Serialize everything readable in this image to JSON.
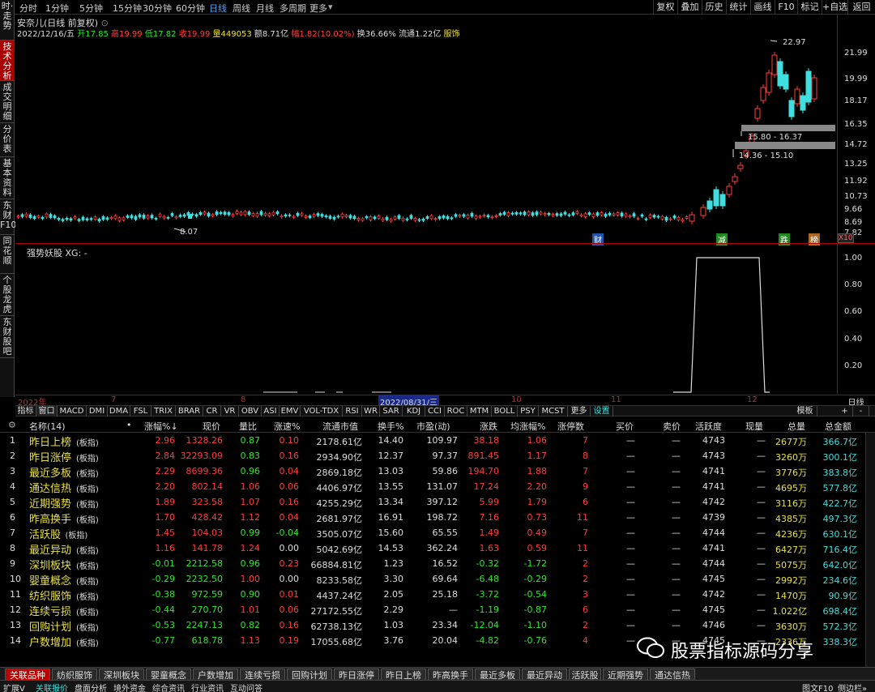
{
  "toolbar": {
    "periods": [
      "分时",
      "1分钟",
      "5分钟",
      "15分钟",
      "30分钟",
      "60分钟",
      "日线",
      "周线",
      "月线",
      "多周期",
      "更多"
    ],
    "active_period": "日线",
    "right_buttons": [
      "复权",
      "叠加",
      "历史",
      "统计",
      "画线",
      "F10",
      "标记",
      "+自选",
      "返回"
    ]
  },
  "left_tabs": [
    "时·走势",
    "技术分析",
    "成交明细",
    "分价表",
    "基本资料",
    "东财F10",
    "同花顺",
    "个股龙虎",
    "东财股吧"
  ],
  "left_tabs_active": "技术分析",
  "stock": {
    "title": "安奈儿(日线 前复权)",
    "date": "2022/12/16/五",
    "open_label": "开",
    "open": "17.85",
    "high_label": "高",
    "high": "19.99",
    "low_label": "低",
    "low": "17.82",
    "close_label": "收",
    "close": "19.99",
    "vol_label": "量",
    "vol": "449053",
    "amount_label": "额",
    "amount": "8.71亿",
    "change_label": "幅",
    "change": "1.82(10.02%)",
    "turnover_label": "换",
    "turnover": "36.66%",
    "float_label": "流通",
    "float": "1.22亿",
    "sector": "服饰"
  },
  "kline_axis": [
    "21.99",
    "19.99",
    "18.17",
    "16.35",
    "14.72",
    "13.25",
    "11.92",
    "10.73",
    "9.66",
    "8.69",
    "7.82"
  ],
  "kline_annotations": {
    "high_mark": "22.97",
    "low_mark": "8.07",
    "gap1": "15.80 - 16.37",
    "gap2": "14.36 - 15.10",
    "axis_tag": "X10"
  },
  "event_markers": [
    "财",
    "减",
    "跌",
    "榜"
  ],
  "indicator": {
    "title": "强势妖股  XG: -",
    "axis": [
      "1.00",
      "0.80",
      "0.60",
      "0.40",
      "0.20"
    ],
    "series": [
      0,
      0,
      0,
      0,
      0,
      0,
      0,
      0,
      0,
      0,
      0,
      0,
      0,
      0,
      0,
      0,
      0,
      0,
      0,
      1,
      1,
      1,
      1,
      1,
      1,
      1,
      1,
      0
    ]
  },
  "date_axis": {
    "labels": [
      "2022年",
      "7",
      "8",
      "2022/08/31/三",
      "10",
      "11",
      "12"
    ],
    "period": "日线"
  },
  "indicator_tabs": [
    "指标",
    "窗口",
    "MACD",
    "DMI",
    "DMA",
    "FSL",
    "TRIX",
    "BRAR",
    "CR",
    "VR",
    "OBV",
    "ASI",
    "EMV",
    "VOL-TDX",
    "RSI",
    "WR",
    "SAR",
    "KDJ",
    "CCI",
    "ROC",
    "MTM",
    "BOLL",
    "PSY",
    "MCST",
    "更多",
    "设置",
    "模板",
    "+",
    "-"
  ],
  "table": {
    "headers": [
      "名称(14)",
      "•",
      "涨幅%↓",
      "现价",
      "量比",
      "涨速%",
      "流通市值",
      "换手%",
      "市盈(动)",
      "涨跌",
      "均涨幅%",
      "涨停数",
      "买价",
      "卖价",
      "活跃度",
      "现量",
      "总量",
      "总金额"
    ],
    "tag": "(板指)",
    "rows": [
      {
        "no": "1",
        "name": "昨日上榜",
        "pct": "2.96",
        "price": "1328.26",
        "vr": "0.87",
        "spd": "0.10",
        "mv": "2178.61亿",
        "to": "14.40",
        "pe": "109.97",
        "chg": "38.18",
        "avg": "1.06",
        "lim": "7",
        "buy": "—",
        "sell": "—",
        "act": "4743",
        "cur": "—",
        "vol": "2677万",
        "amt": "366.7亿"
      },
      {
        "no": "2",
        "name": "昨日涨停",
        "pct": "2.84",
        "price": "32293.09",
        "vr": "0.83",
        "spd": "0.16",
        "mv": "2934.90亿",
        "to": "12.37",
        "pe": "97.37",
        "chg": "891.45",
        "avg": "1.17",
        "lim": "8",
        "buy": "—",
        "sell": "—",
        "act": "4743",
        "cur": "—",
        "vol": "3260万",
        "amt": "300.1亿"
      },
      {
        "no": "3",
        "name": "最近多板",
        "pct": "2.29",
        "price": "8699.36",
        "vr": "0.96",
        "spd": "0.04",
        "mv": "2869.18亿",
        "to": "13.03",
        "pe": "59.86",
        "chg": "194.70",
        "avg": "1.88",
        "lim": "7",
        "buy": "—",
        "sell": "—",
        "act": "4741",
        "cur": "—",
        "vol": "3776万",
        "amt": "383.8亿"
      },
      {
        "no": "4",
        "name": "通达信热",
        "pct": "2.20",
        "price": "802.14",
        "vr": "1.06",
        "spd": "0.06",
        "mv": "4406.97亿",
        "to": "13.55",
        "pe": "131.07",
        "chg": "17.24",
        "avg": "2.20",
        "lim": "9",
        "buy": "—",
        "sell": "—",
        "act": "4741",
        "cur": "—",
        "vol": "4695万",
        "amt": "577.8亿"
      },
      {
        "no": "5",
        "name": "近期强势",
        "pct": "1.89",
        "price": "323.58",
        "vr": "1.07",
        "spd": "0.16",
        "mv": "4255.29亿",
        "to": "13.34",
        "pe": "397.12",
        "chg": "5.99",
        "avg": "1.79",
        "lim": "6",
        "buy": "—",
        "sell": "—",
        "act": "4742",
        "cur": "—",
        "vol": "3116万",
        "amt": "422.7亿"
      },
      {
        "no": "6",
        "name": "昨高换手",
        "pct": "1.70",
        "price": "428.42",
        "vr": "1.12",
        "spd": "0.04",
        "mv": "2681.97亿",
        "to": "16.91",
        "pe": "198.72",
        "chg": "7.16",
        "avg": "0.73",
        "lim": "11",
        "buy": "—",
        "sell": "—",
        "act": "4739",
        "cur": "—",
        "vol": "4385万",
        "amt": "497.3亿"
      },
      {
        "no": "7",
        "name": "活跃股",
        "pct": "1.45",
        "price": "104.03",
        "vr": "0.99",
        "spd": "-0.04",
        "mv": "3505.07亿",
        "to": "15.60",
        "pe": "65.55",
        "chg": "1.49",
        "avg": "0.49",
        "lim": "7",
        "buy": "—",
        "sell": "—",
        "act": "4744",
        "cur": "—",
        "vol": "4236万",
        "amt": "630.1亿"
      },
      {
        "no": "8",
        "name": "最近异动",
        "pct": "1.16",
        "price": "141.78",
        "vr": "1.24",
        "spd": "0.00",
        "mv": "5042.69亿",
        "to": "14.53",
        "pe": "362.24",
        "chg": "1.63",
        "avg": "0.59",
        "lim": "11",
        "buy": "—",
        "sell": "—",
        "act": "4741",
        "cur": "—",
        "vol": "6427万",
        "amt": "716.4亿"
      },
      {
        "no": "9",
        "name": "深圳板块",
        "pct": "-0.01",
        "price": "2212.58",
        "vr": "0.96",
        "spd": "0.23",
        "mv": "66884.81亿",
        "to": "1.23",
        "pe": "16.52",
        "chg": "-0.32",
        "avg": "-1.72",
        "lim": "2",
        "buy": "—",
        "sell": "—",
        "act": "4744",
        "cur": "—",
        "vol": "5075万",
        "amt": "642.0亿"
      },
      {
        "no": "10",
        "name": "婴童概念",
        "pct": "-0.29",
        "price": "2232.50",
        "vr": "1.00",
        "spd": "0.00",
        "mv": "8233.58亿",
        "to": "3.30",
        "pe": "69.64",
        "chg": "-6.48",
        "avg": "-0.29",
        "lim": "2",
        "buy": "—",
        "sell": "—",
        "act": "4745",
        "cur": "—",
        "vol": "2992万",
        "amt": "234.6亿"
      },
      {
        "no": "11",
        "name": "纺织服饰",
        "pct": "-0.38",
        "price": "972.59",
        "vr": "0.90",
        "spd": "0.01",
        "mv": "4437.24亿",
        "to": "2.05",
        "pe": "25.18",
        "chg": "-3.72",
        "avg": "-0.54",
        "lim": "3",
        "buy": "—",
        "sell": "—",
        "act": "4742",
        "cur": "—",
        "vol": "1470万",
        "amt": "90.9亿"
      },
      {
        "no": "12",
        "name": "连续亏损",
        "pct": "-0.44",
        "price": "270.70",
        "vr": "1.01",
        "spd": "0.06",
        "mv": "27172.55亿",
        "to": "2.29",
        "pe": "—",
        "chg": "-1.19",
        "avg": "-0.87",
        "lim": "6",
        "buy": "—",
        "sell": "—",
        "act": "4745",
        "cur": "—",
        "vol": "1.022亿",
        "amt": "698.4亿"
      },
      {
        "no": "13",
        "name": "回购计划",
        "pct": "-0.53",
        "price": "2247.13",
        "vr": "0.82",
        "spd": "0.16",
        "mv": "62738.13亿",
        "to": "1.03",
        "pe": "23.34",
        "chg": "-12.04",
        "avg": "-1.10",
        "lim": "2",
        "buy": "—",
        "sell": "—",
        "act": "4746",
        "cur": "—",
        "vol": "3630万",
        "amt": "572.3亿"
      },
      {
        "no": "14",
        "name": "户数增加",
        "pct": "-0.77",
        "price": "618.78",
        "vr": "1.13",
        "spd": "0.19",
        "mv": "17055.68亿",
        "to": "3.76",
        "pe": "20.04",
        "chg": "-4.82",
        "avg": "-0.76",
        "lim": "4",
        "buy": "—",
        "sell": "—",
        "act": "4745",
        "cur": "—",
        "vol": "2336万",
        "amt": "338.3亿"
      }
    ]
  },
  "bottom_tabs": [
    "关联品种",
    "纺织服饰",
    "深圳板块",
    "婴童概念",
    "户数增加",
    "连续亏损",
    "回购计划",
    "昨日涨停",
    "昨日上榜",
    "昨高换手",
    "最近多板",
    "最近异动",
    "活跃股",
    "近期强势",
    "通达信热"
  ],
  "status_items": [
    "扩展V",
    "关联报价",
    "盘面分析",
    "境外资金",
    "综合资讯",
    "行业资讯",
    "互动问答"
  ],
  "status_right": [
    "图文F10",
    "侧边栏»"
  ],
  "watermark": "股票指标源码分享"
}
